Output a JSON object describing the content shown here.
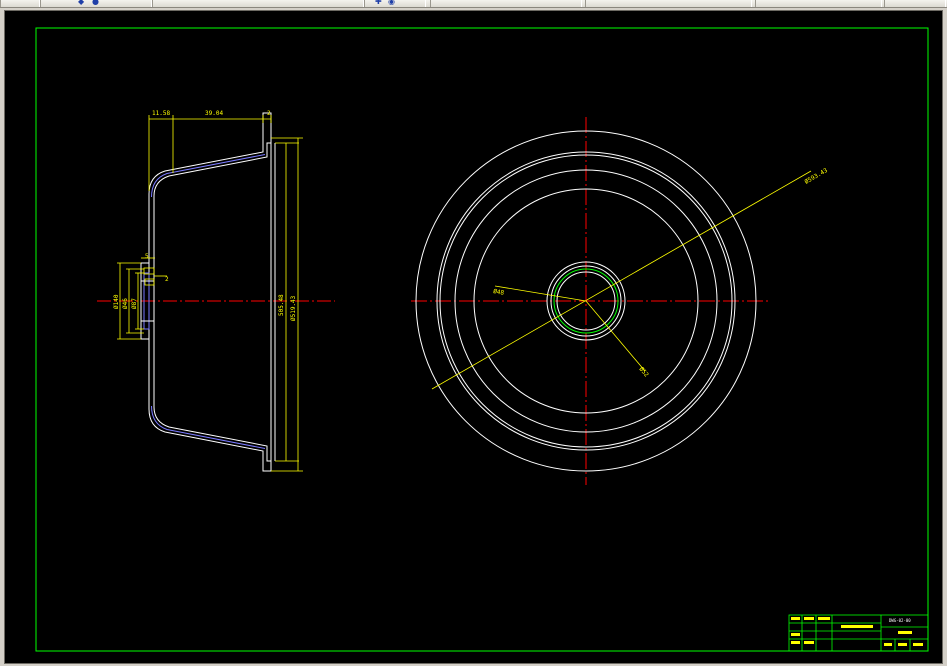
{
  "colors": {
    "frame": "#00ff00",
    "outline": "#ffffff",
    "dimension": "#ffff00",
    "centerline": "#ff0000",
    "background": "#000000"
  },
  "toolbar": {
    "icons": [
      "toolbar-icon-group"
    ]
  },
  "section_view": {
    "dims": {
      "top_left": "11.58",
      "top_mid": "39.04",
      "top_right": "2",
      "inner_height": "505.48",
      "outer_height": "Ø519.43",
      "hub_small": "5",
      "hub_right": "2",
      "hub_left_1": "Ø140",
      "hub_left_2": "Ø46",
      "hub_left_3": "Ø87"
    }
  },
  "plan_view": {
    "dims": {
      "outer_diameter": "Ø593.43",
      "hub_diameter": "Ø48",
      "hub_inner": "Ø52"
    }
  },
  "title_block": {
    "drawing_no": "DWG-02-00"
  }
}
